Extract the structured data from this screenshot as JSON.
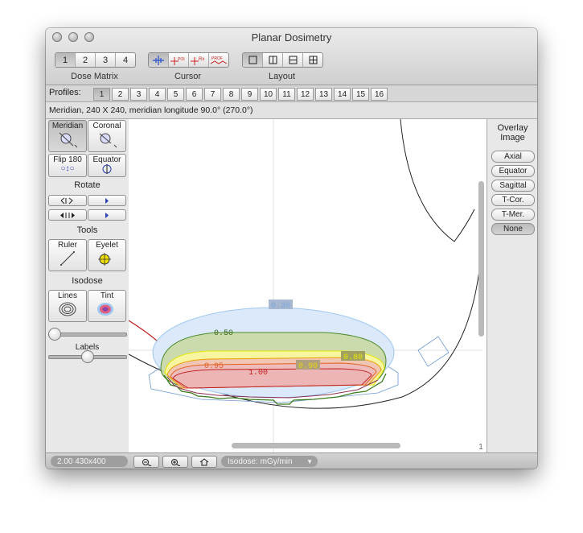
{
  "window": {
    "title": "Planar Dosimetry"
  },
  "toolbar": {
    "dose_matrix": {
      "label": "Dose Matrix",
      "options": [
        "1",
        "2",
        "3",
        "4"
      ],
      "selected": "1"
    },
    "cursor": {
      "label": "Cursor",
      "icons": [
        "crosshair-icon",
        "poi-cursor-icon",
        "rx-cursor-icon",
        "profile-cursor-icon"
      ],
      "poi_text": "POI",
      "rx_text": "Rx",
      "prof_text": "PROF"
    },
    "layout": {
      "label": "Layout",
      "icons": [
        "single-view-icon",
        "two-column-icon",
        "two-row-icon",
        "four-quadrant-icon"
      ]
    }
  },
  "profiles": {
    "label": "Profiles:",
    "items": [
      "1",
      "2",
      "3",
      "4",
      "5",
      "6",
      "7",
      "8",
      "9",
      "10",
      "11",
      "12",
      "13",
      "14",
      "15",
      "16"
    ],
    "selected": "1"
  },
  "info": {
    "text": "Meridian, 240 X 240, meridian longitude 90.0° (270.0°)"
  },
  "left_panel": {
    "views": [
      {
        "label": "Meridian",
        "icon": "meridian-eye-icon",
        "selected": true
      },
      {
        "label": "Coronal",
        "icon": "coronal-eye-icon",
        "selected": false
      },
      {
        "label": "Flip 180",
        "icon": "flip-icon",
        "glyph": "○↕○"
      },
      {
        "label": "Equator",
        "icon": "equator-icon"
      }
    ],
    "rotate_heading": "Rotate",
    "tools_heading": "Tools",
    "tools": [
      {
        "label": "Ruler",
        "icon": "ruler-icon"
      },
      {
        "label": "Eyelet",
        "icon": "eyelet-icon"
      }
    ],
    "isodose_heading": "Isodose",
    "isodose": [
      {
        "label": "Lines",
        "icon": "isodose-lines-icon"
      },
      {
        "label": "Tint",
        "icon": "isodose-tint-icon"
      }
    ],
    "labels_slider": "Labels",
    "top_slider_value": 0.0,
    "labels_slider_value": 0.5
  },
  "plot": {
    "isodose_labels": [
      "0.30",
      "0.50",
      "0.80",
      "0.90",
      "0.95",
      "1.00"
    ],
    "colors": {
      "0.30": "#9ec8f0",
      "0.50": "#4a8a2a",
      "0.80": "#e6e600",
      "0.90": "#e8a000",
      "0.95": "#e06020",
      "1.00": "#c02020"
    },
    "page_indicator": "1"
  },
  "overlay": {
    "heading_line1": "Overlay",
    "heading_line2": "Image",
    "buttons": [
      "Axial",
      "Equator",
      "Sagittal",
      "T-Cor.",
      "T-Mer.",
      "None"
    ],
    "selected": "None"
  },
  "statusbar": {
    "zoom": "2.00 430x400",
    "isodose_units": "Isodose: mGy/min"
  }
}
